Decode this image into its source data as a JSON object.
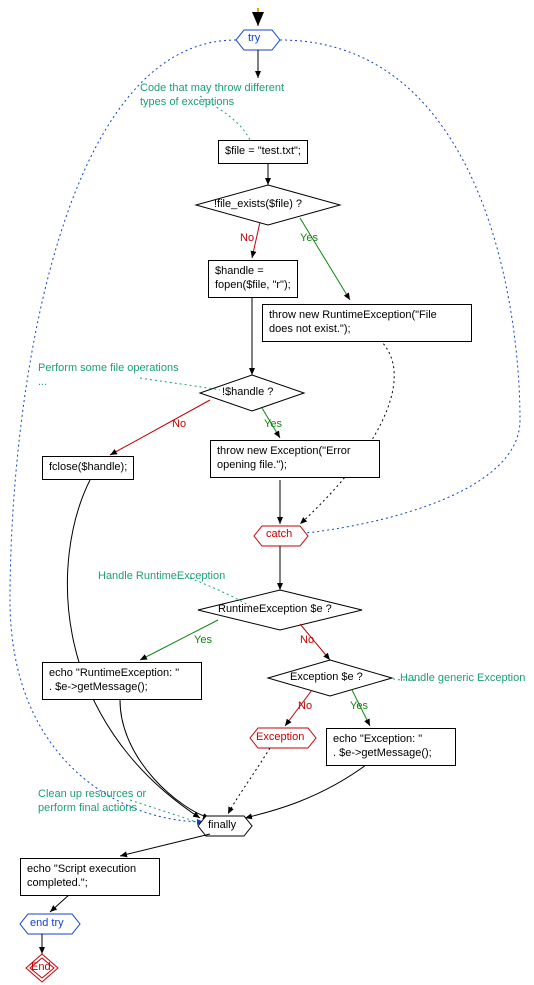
{
  "chart_data": {
    "type": "flowchart",
    "nodes": [
      {
        "id": "start-arrow",
        "shape": "start-arrow",
        "label": ""
      },
      {
        "id": "try",
        "shape": "hexagon",
        "label": "try",
        "stroke": "#1040d0"
      },
      {
        "id": "c1",
        "shape": "comment",
        "label": "Code that may throw different\ntypes of exceptions"
      },
      {
        "id": "n-file",
        "shape": "rect",
        "label": "$file = \"test.txt\";"
      },
      {
        "id": "d-exists",
        "shape": "diamond",
        "label": "!file_exists($file) ?"
      },
      {
        "id": "n-fopen",
        "shape": "rect",
        "label": "$handle =\nfopen($file, \"r\");"
      },
      {
        "id": "n-throw-rt",
        "shape": "rect",
        "label": "throw new RuntimeException(\"File\ndoes not exist.\");"
      },
      {
        "id": "c2",
        "shape": "comment",
        "label": "Perform some file operations\n..."
      },
      {
        "id": "d-handle",
        "shape": "diamond",
        "label": "!$handle ?"
      },
      {
        "id": "n-fclose",
        "shape": "rect",
        "label": "fclose($handle);"
      },
      {
        "id": "n-throw-ex",
        "shape": "rect",
        "label": "throw new Exception(\"Error\nopening file.\");"
      },
      {
        "id": "catch",
        "shape": "hexagon",
        "label": "catch",
        "stroke": "#c00000"
      },
      {
        "id": "c3",
        "shape": "comment",
        "label": "Handle RuntimeException"
      },
      {
        "id": "d-rt",
        "shape": "diamond",
        "label": "RuntimeException $e ?"
      },
      {
        "id": "n-echo-rt",
        "shape": "rect",
        "label": "echo \"RuntimeException: \"\n. $e->getMessage();"
      },
      {
        "id": "d-ex",
        "shape": "diamond",
        "label": "Exception $e ?"
      },
      {
        "id": "c4",
        "shape": "comment",
        "label": "Handle generic Exception"
      },
      {
        "id": "n-exception",
        "shape": "hexagon",
        "label": "Exception",
        "stroke": "#c00000"
      },
      {
        "id": "n-echo-ex",
        "shape": "rect",
        "label": "echo \"Exception: \"\n. $e->getMessage();"
      },
      {
        "id": "c5",
        "shape": "comment",
        "label": "Clean up resources or\nperform final actions"
      },
      {
        "id": "finally",
        "shape": "hexagon",
        "label": "finally",
        "stroke": "#000"
      },
      {
        "id": "n-echo-done",
        "shape": "rect",
        "label": "echo \"Script execution\ncompleted.\";"
      },
      {
        "id": "endtry",
        "shape": "hexagon",
        "label": "end try",
        "stroke": "#1040d0"
      },
      {
        "id": "end",
        "shape": "terminator",
        "label": "End",
        "stroke": "#c00000"
      }
    ],
    "edges": [
      {
        "from": "try",
        "to": "n-file"
      },
      {
        "from": "n-file",
        "to": "d-exists"
      },
      {
        "from": "d-exists",
        "to": "n-fopen",
        "label": "No"
      },
      {
        "from": "d-exists",
        "to": "n-throw-rt",
        "label": "Yes"
      },
      {
        "from": "n-fopen",
        "to": "d-handle"
      },
      {
        "from": "d-handle",
        "to": "n-fclose",
        "label": "No"
      },
      {
        "from": "d-handle",
        "to": "n-throw-ex",
        "label": "Yes"
      },
      {
        "from": "n-throw-rt",
        "to": "catch",
        "style": "dotted"
      },
      {
        "from": "n-throw-ex",
        "to": "catch",
        "style": "dotted"
      },
      {
        "from": "catch",
        "to": "d-rt"
      },
      {
        "from": "d-rt",
        "to": "n-echo-rt",
        "label": "Yes"
      },
      {
        "from": "d-rt",
        "to": "d-ex",
        "label": "No"
      },
      {
        "from": "d-ex",
        "to": "n-echo-ex",
        "label": "Yes"
      },
      {
        "from": "d-ex",
        "to": "n-exception",
        "label": "No"
      },
      {
        "from": "n-echo-rt",
        "to": "finally"
      },
      {
        "from": "n-echo-ex",
        "to": "finally"
      },
      {
        "from": "n-fclose",
        "to": "finally"
      },
      {
        "from": "try",
        "to": "finally",
        "style": "dotted-blue"
      },
      {
        "from": "finally",
        "to": "n-echo-done"
      },
      {
        "from": "n-echo-done",
        "to": "endtry"
      },
      {
        "from": "endtry",
        "to": "end"
      }
    ]
  },
  "labels": {
    "try": "try",
    "c1": "Code that may throw different\ntypes of exceptions",
    "n_file": "$file = \"test.txt\";",
    "d_exists": "!file_exists($file) ?",
    "n_fopen": "$handle =\nfopen($file, \"r\");",
    "n_throw_rt": "throw new RuntimeException(\"File\ndoes not exist.\");",
    "c2": "Perform some file operations\n...",
    "d_handle": "!$handle ?",
    "n_fclose": "fclose($handle);",
    "n_throw_ex": "throw new Exception(\"Error\nopening file.\");",
    "catch": "catch",
    "c3": "Handle RuntimeException",
    "d_rt": "RuntimeException $e ?",
    "n_echo_rt": "echo \"RuntimeException: \"\n. $e->getMessage();",
    "d_ex": "Exception $e ?",
    "c4": "Handle generic Exception",
    "n_exception": "Exception",
    "n_echo_ex": "echo \"Exception: \"\n. $e->getMessage();",
    "c5": "Clean up resources or\nperform final actions",
    "finally": "finally",
    "n_echo_done": "echo \"Script execution\ncompleted.\";",
    "endtry": "end try",
    "end": "End",
    "yes": "Yes",
    "no": "No"
  }
}
